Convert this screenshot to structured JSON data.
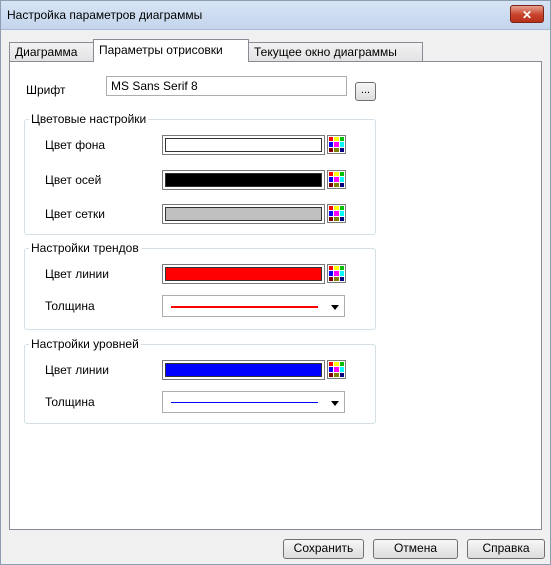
{
  "window": {
    "title": "Настройка параметров диаграммы",
    "close_label": "✕"
  },
  "tabs": [
    {
      "label": "Диаграмма"
    },
    {
      "label": "Параметры отрисовки"
    },
    {
      "label": "Текущее окно диаграммы"
    }
  ],
  "font": {
    "label": "Шрифт",
    "value": "MS Sans Serif 8",
    "button_label": "..."
  },
  "color_settings": {
    "title": "Цветовые настройки",
    "rows": [
      {
        "label": "Цвет фона",
        "color": "#ffffff"
      },
      {
        "label": "Цвет осей",
        "color": "#000000"
      },
      {
        "label": "Цвет сетки",
        "color": "#c0c0c0"
      }
    ]
  },
  "trend_settings": {
    "title": "Настройки трендов",
    "line_color_label": "Цвет линии",
    "line_color": "#ff0000",
    "thickness_label": "Толщина",
    "thickness_color": "#ff0000"
  },
  "level_settings": {
    "title": "Настройки уровней",
    "line_color_label": "Цвет линии",
    "line_color": "#0000ff",
    "thickness_label": "Толщина",
    "thickness_color": "#0000ff"
  },
  "buttons": {
    "save": "Сохранить",
    "cancel": "Отмена",
    "help": "Справка"
  }
}
